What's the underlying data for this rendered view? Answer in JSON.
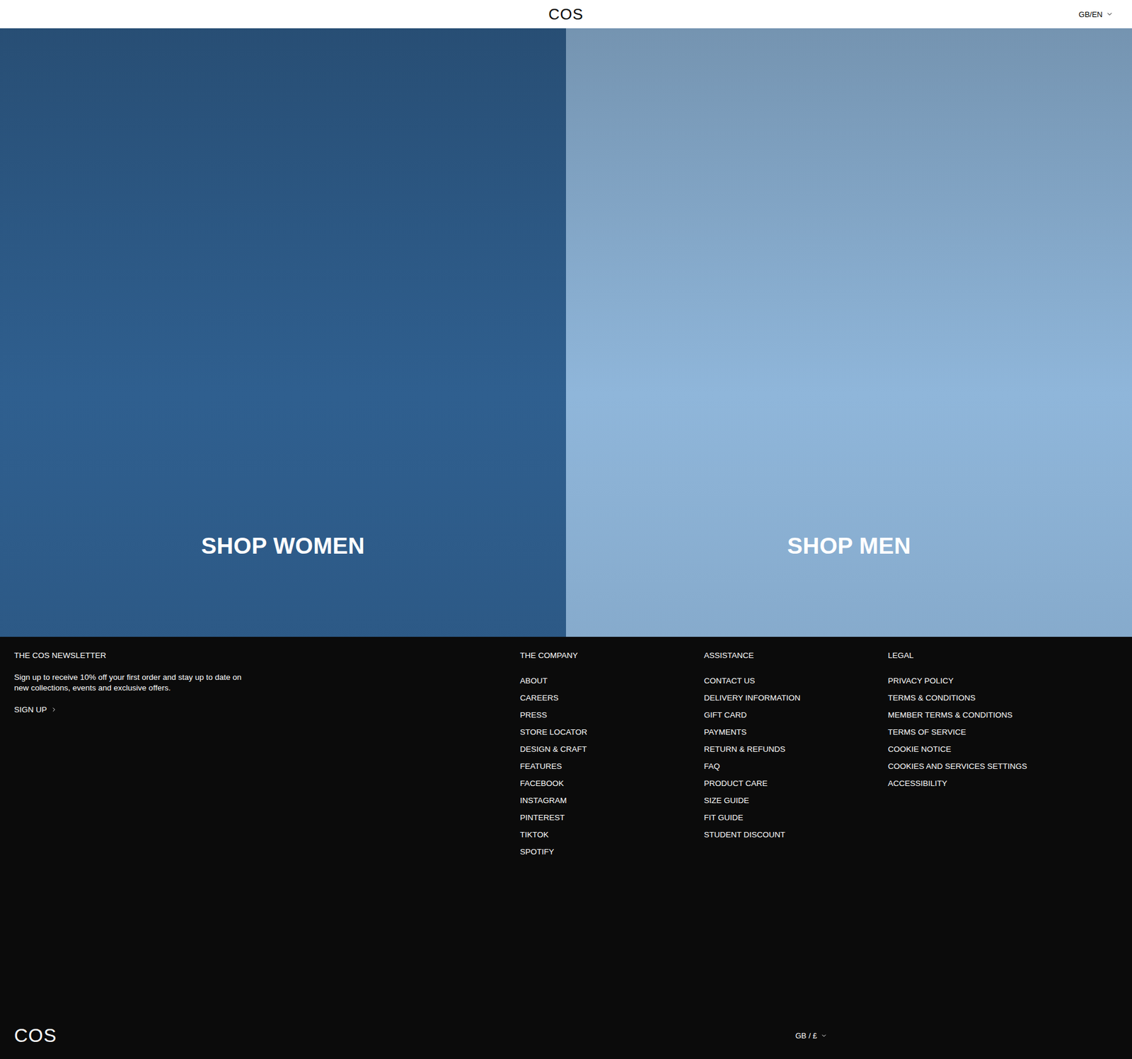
{
  "header": {
    "logo": "COS",
    "locale": "GB/EN"
  },
  "hero": [
    {
      "label": "SHOP WOMEN",
      "color": "#2f5f8f"
    },
    {
      "label": "SHOP MEN",
      "color": "#8fb6da"
    }
  ],
  "newsletter": {
    "title": "THE COS NEWSLETTER",
    "text": "Sign up to receive 10% off your first order and stay up to date on new collections, events and exclusive offers.",
    "cta": "SIGN UP"
  },
  "columns": [
    {
      "title": "THE COMPANY",
      "links": [
        "ABOUT",
        "CAREERS",
        "PRESS",
        "STORE LOCATOR",
        "DESIGN & CRAFT",
        "FEATURES",
        "FACEBOOK",
        "INSTAGRAM",
        "PINTEREST",
        "TIKTOK",
        "SPOTIFY"
      ]
    },
    {
      "title": "ASSISTANCE",
      "links": [
        "CONTACT US",
        "DELIVERY INFORMATION",
        "GIFT CARD",
        "PAYMENTS",
        "RETURN & REFUNDS",
        "FAQ",
        "PRODUCT CARE",
        "SIZE GUIDE",
        "FIT GUIDE",
        "STUDENT DISCOUNT"
      ]
    },
    {
      "title": "LEGAL",
      "links": [
        "PRIVACY POLICY",
        "TERMS & CONDITIONS",
        "MEMBER TERMS & CONDITIONS",
        "TERMS OF SERVICE",
        "COOKIE NOTICE",
        "COOKIES AND SERVICES SETTINGS",
        "ACCESSIBILITY"
      ]
    }
  ],
  "bottom": {
    "logo": "COS",
    "currency": "GB / £"
  }
}
